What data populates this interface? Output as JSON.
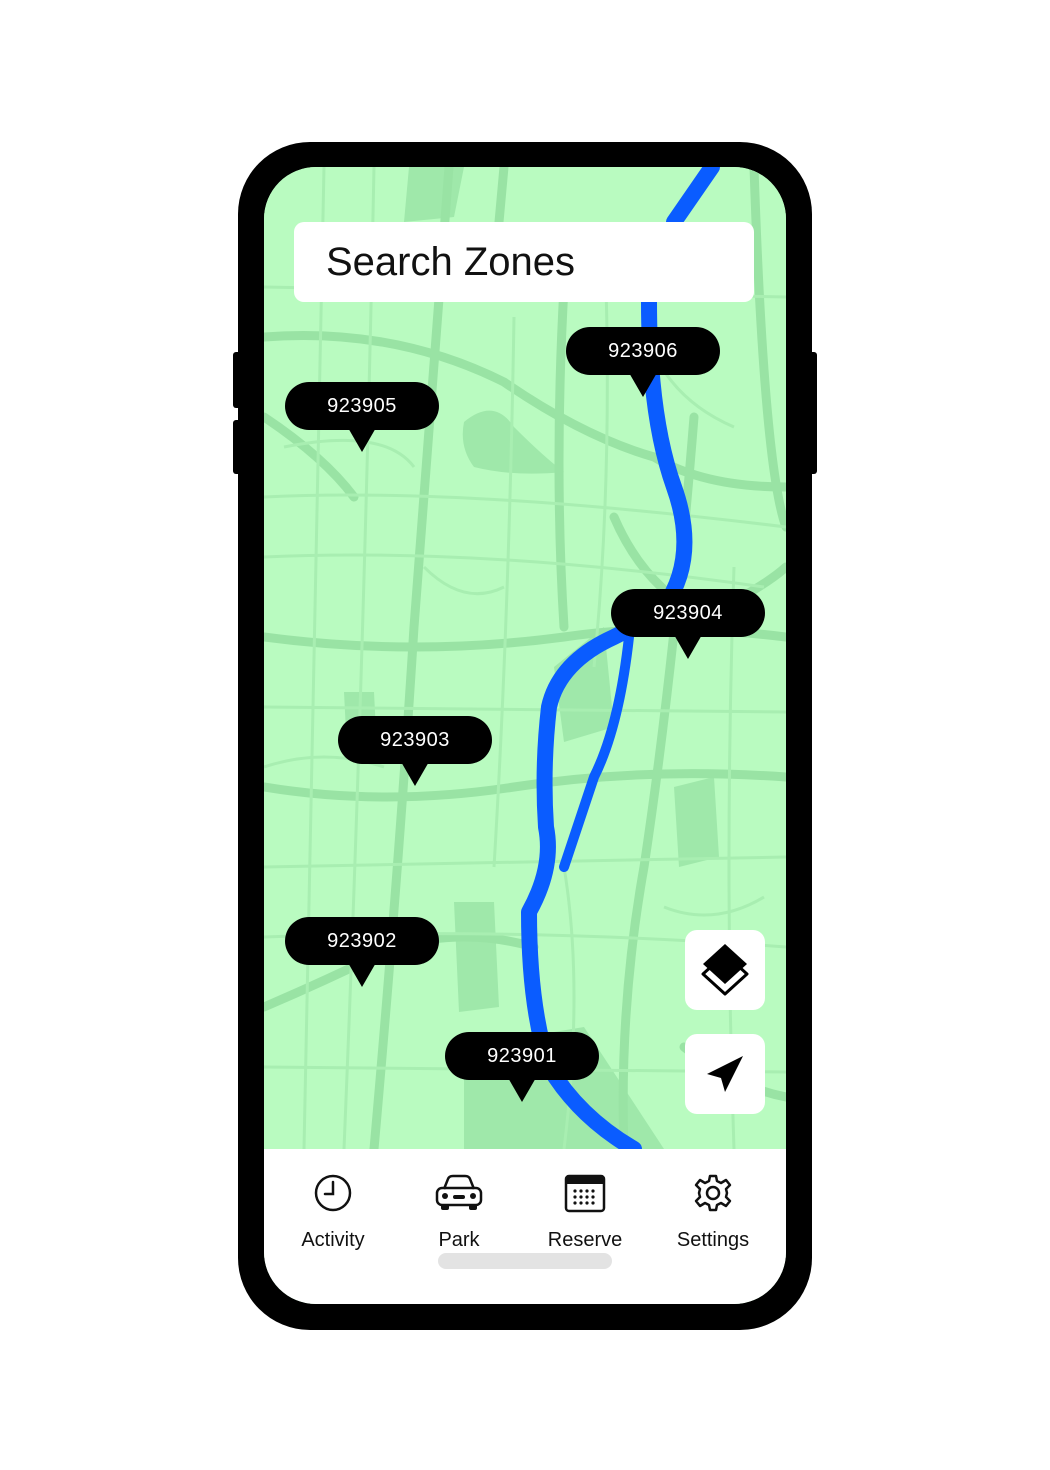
{
  "search": {
    "placeholder": "Search Zones"
  },
  "zones": [
    {
      "id": "923906"
    },
    {
      "id": "923905"
    },
    {
      "id": "923904"
    },
    {
      "id": "923903"
    },
    {
      "id": "923902"
    },
    {
      "id": "923901"
    }
  ],
  "map_controls": [
    {
      "icon": "layers-icon"
    },
    {
      "icon": "location-arrow-icon"
    }
  ],
  "tabs": [
    {
      "label": "Activity",
      "icon": "clock-icon"
    },
    {
      "label": "Park",
      "icon": "car-icon"
    },
    {
      "label": "Reserve",
      "icon": "calendar-icon"
    },
    {
      "label": "Settings",
      "icon": "gear-icon"
    }
  ],
  "colors": {
    "map_background": "#b9fbc0",
    "roads": "#99e3a4",
    "river": "#0a5cff",
    "pin": "#000000",
    "phone_frame": "#000000"
  }
}
